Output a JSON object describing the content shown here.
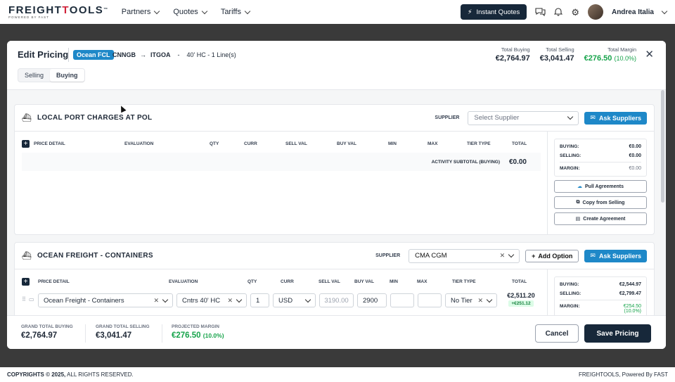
{
  "nav": {
    "logo_pre": "FREIGHT",
    "logo_accent": "T",
    "logo_post": "OOLS",
    "logo_tm": "™",
    "logo_sub": "POWERED BY FAST",
    "items": [
      {
        "label": "Partners"
      },
      {
        "label": "Quotes"
      },
      {
        "label": "Tariffs"
      }
    ],
    "instant_label": "Instant Quotes",
    "user_name": "Andrea Italia"
  },
  "modal": {
    "title": "Edit Pricing",
    "mode_badge": "Ocean FCL",
    "origin": "CNNGB",
    "arrow": "→",
    "destination": "ITGOA",
    "dash": "-",
    "equipment": "40' HC - 1 Line(s)",
    "tabs": [
      {
        "label": "Selling",
        "active": false
      },
      {
        "label": "Buying",
        "active": true
      }
    ],
    "totals": {
      "buying_label": "Total Buying",
      "buying_value": "€2,764.97",
      "selling_label": "Total Selling",
      "selling_value": "€3,041.47",
      "margin_label": "Total Margin",
      "margin_value": "€276.50",
      "margin_pct": "(10.0%)"
    },
    "close_glyph": "✕"
  },
  "columns": {
    "price_detail": "PRICE DETAIL",
    "evaluation": "EVALUATION",
    "qty": "QTY",
    "curr": "CURR",
    "sell_val": "SELL VAL",
    "buy_val": "BUY VAL",
    "min": "MIN",
    "max": "MAX",
    "tier_type": "TIER TYPE",
    "total": "TOTAL"
  },
  "section1": {
    "title": "LOCAL PORT CHARGES AT POL",
    "supplier_label": "SUPPLIER",
    "supplier_placeholder": "Select Supplier",
    "ask_label": "Ask Suppliers",
    "subtotal_label": "ACTIVITY SUBTOTAL (BUYING)",
    "subtotal_value": "€0.00",
    "side": {
      "buying_label": "BUYING:",
      "buying_value": "€0.00",
      "selling_label": "SELLING:",
      "selling_value": "€0.00",
      "margin_label": "MARGIN:",
      "margin_value": "€0.00"
    },
    "buttons": {
      "pull": "Pull Agreements",
      "copy": "Copy from Selling",
      "create": "Create Agreement"
    }
  },
  "section2": {
    "title": "OCEAN FREIGHT - CONTAINERS",
    "supplier_label": "SUPPLIER",
    "supplier_value": "CMA CGM",
    "add_option_label": "Add Option",
    "ask_label": "Ask Suppliers",
    "row": {
      "price_detail": "Ocean Freight - Containers",
      "evaluation": "Cntrs 40' HC",
      "qty": "1",
      "curr": "USD",
      "sell_val": "3190.00",
      "buy_val": "2900",
      "min": "",
      "max": "",
      "tier_type": "No Tier",
      "total": "€2,511.20",
      "margin": "+€251.12"
    },
    "side": {
      "buying_label": "BUYING:",
      "buying_value": "€2,544.97",
      "selling_label": "SELLING:",
      "selling_value": "€2,799.47",
      "margin_label": "MARGIN:",
      "margin_value": "€254.50",
      "margin_pct": "(10.0%)"
    }
  },
  "footer": {
    "grand_buying_label": "GRAND TOTAL BUYING",
    "grand_buying_value": "€2,764.97",
    "grand_selling_label": "GRAND TOTAL SELLING",
    "grand_selling_value": "€3,041.47",
    "margin_label": "PROJECTED MARGIN",
    "margin_value": "€276.50",
    "margin_pct": "(10.0%)",
    "cancel_label": "Cancel",
    "save_label": "Save Pricing"
  },
  "page_footer": {
    "copyright_bold": "COPYRIGHTS © 2025,",
    "copyright_rest": " ALL RIGHTS RESERVED.",
    "brand": "FREIGHTOOLS, Powered By FAST"
  },
  "colors": {
    "accent_blue": "#1e88c8",
    "dark_navy": "#17283a",
    "margin_green": "#16a34a",
    "logo_red": "#d0223a"
  },
  "icons": [
    "lightning-icon",
    "chat-icon",
    "bell-icon",
    "gear-icon",
    "ship-icon",
    "mail-icon",
    "cloud-download-icon",
    "copy-icon",
    "document-icon",
    "plus-icon",
    "drag-handle-icon",
    "comment-icon",
    "chevron-down-icon",
    "clear-icon",
    "close-icon"
  ]
}
